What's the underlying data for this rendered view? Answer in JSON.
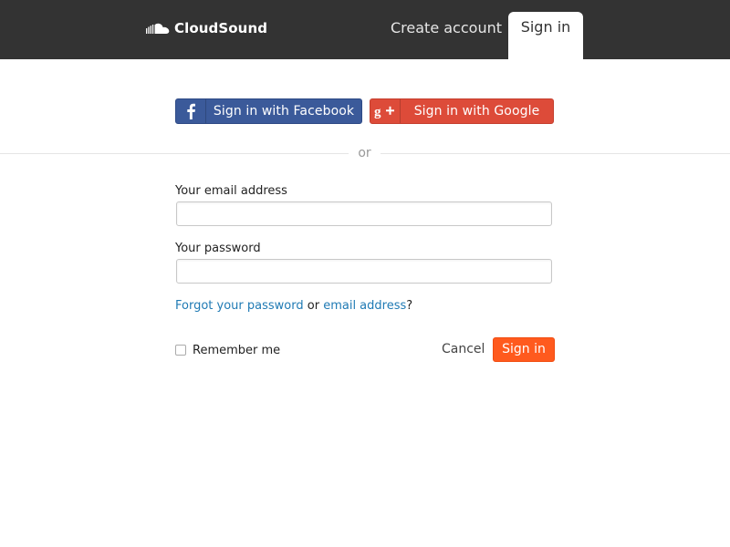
{
  "header": {
    "brand": "CloudSound",
    "nav_create": "Create account",
    "nav_signin": "Sign in"
  },
  "social": {
    "facebook_label": "Sign in with Facebook",
    "google_label": "Sign in with Google"
  },
  "divider_text": "or",
  "form": {
    "email_label": "Your email address",
    "email_value": "",
    "password_label": "Your password",
    "password_value": "",
    "forgot_password_link": "Forgot your password",
    "forgot_or": "or",
    "forgot_email_link": "email address",
    "forgot_suffix": "?",
    "remember_label": "Remember me",
    "remember_checked": false,
    "cancel_label": "Cancel",
    "submit_label": "Sign in"
  },
  "colors": {
    "topbar": "#333333",
    "facebook": "#3b5a9a",
    "google": "#dd4b39",
    "primary": "#ff5a1e",
    "link": "#1f7ab4"
  },
  "icons": {
    "brand": "cloud-logo-icon",
    "facebook": "facebook-icon",
    "google": "google-plus-icon"
  }
}
